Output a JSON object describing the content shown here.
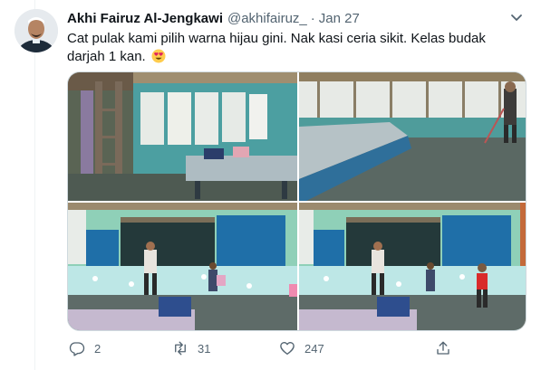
{
  "tweet": {
    "author_name": "Akhi Fairuz Al-Jengkawi",
    "handle": "@akhifairuz_",
    "separator": "·",
    "date": "Jan 27",
    "text": "Cat pulak kami pilih warna hijau gini. Nak kasi ceria sikit. Kelas budak darjah 1 kan.",
    "emoji": "smiling-face-with-heart-eyes",
    "avatar_icon": "avatar-icon",
    "menu_icon": "chevron-down-icon"
  },
  "media": {
    "count": 4,
    "photos": [
      {
        "icon": "classroom-photo-tables-windows"
      },
      {
        "icon": "classroom-photo-man-sweeping"
      },
      {
        "icon": "classroom-photo-blackboard-children"
      },
      {
        "icon": "classroom-photo-blackboard-children-2"
      }
    ]
  },
  "actions": {
    "reply": {
      "icon": "reply-icon",
      "count": "2"
    },
    "retweet": {
      "icon": "retweet-icon",
      "count": "31"
    },
    "like": {
      "icon": "heart-icon",
      "count": "247"
    },
    "share": {
      "icon": "share-icon",
      "count": ""
    }
  },
  "colors": {
    "text": "#0f1419",
    "secondary_text": "#536471",
    "border": "#cfd9de",
    "wall_green": "#8fd0b8",
    "board_blue": "#1f6fa8"
  }
}
